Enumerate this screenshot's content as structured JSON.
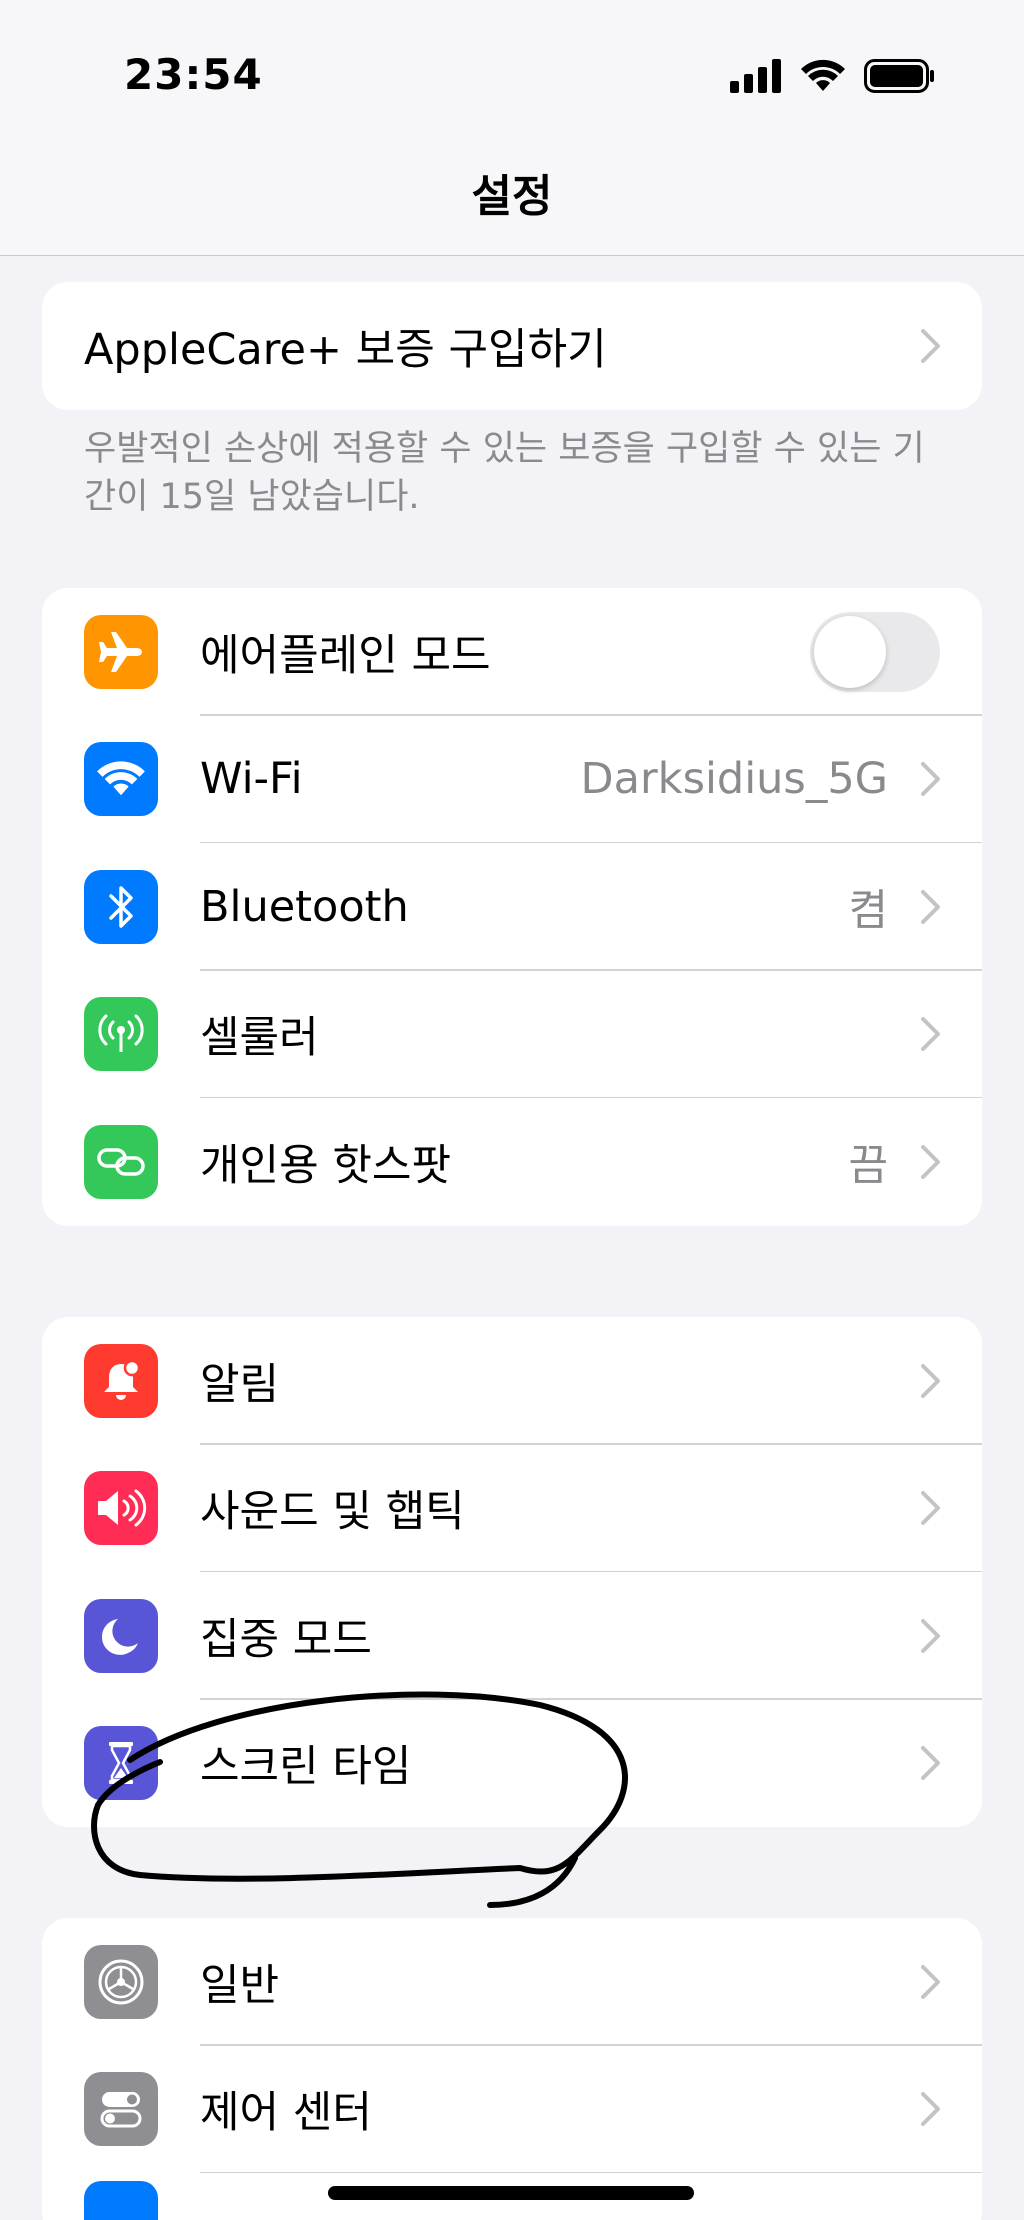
{
  "status_bar": {
    "time": "23:54"
  },
  "nav": {
    "title": "설정"
  },
  "applecare": {
    "label": "AppleCare+ 보증 구입하기",
    "footnote": "우발적인 손상에 적용할 수 있는 보증을 구입할 수 있는 기간이 15일 남았습니다."
  },
  "connectivity": [
    {
      "label": "에어플레인 모드",
      "icon": "airplane-icon",
      "color": "#ff9500",
      "toggle": "off"
    },
    {
      "label": "Wi-Fi",
      "value": "Darksidius_5G",
      "icon": "wifi-icon",
      "color": "#007aff"
    },
    {
      "label": "Bluetooth",
      "value": "켬",
      "icon": "bluetooth-icon",
      "color": "#007aff"
    },
    {
      "label": "셀룰러",
      "icon": "cellular-antenna-icon",
      "color": "#34c759"
    },
    {
      "label": "개인용 핫스팟",
      "value": "끔",
      "icon": "hotspot-link-icon",
      "color": "#34c759"
    }
  ],
  "focus": [
    {
      "label": "알림",
      "icon": "bell-icon",
      "color": "#ff3b30"
    },
    {
      "label": "사운드 및 햅틱",
      "icon": "speaker-icon",
      "color": "#ff2d55"
    },
    {
      "label": "집중 모드",
      "icon": "moon-icon",
      "color": "#5856d6"
    },
    {
      "label": "스크린 타임",
      "icon": "hourglass-icon",
      "color": "#5856d6"
    }
  ],
  "general": [
    {
      "label": "일반",
      "icon": "gear-icon",
      "color": "#8e8e93"
    },
    {
      "label": "제어 센터",
      "icon": "toggles-icon",
      "color": "#8e8e93"
    }
  ]
}
